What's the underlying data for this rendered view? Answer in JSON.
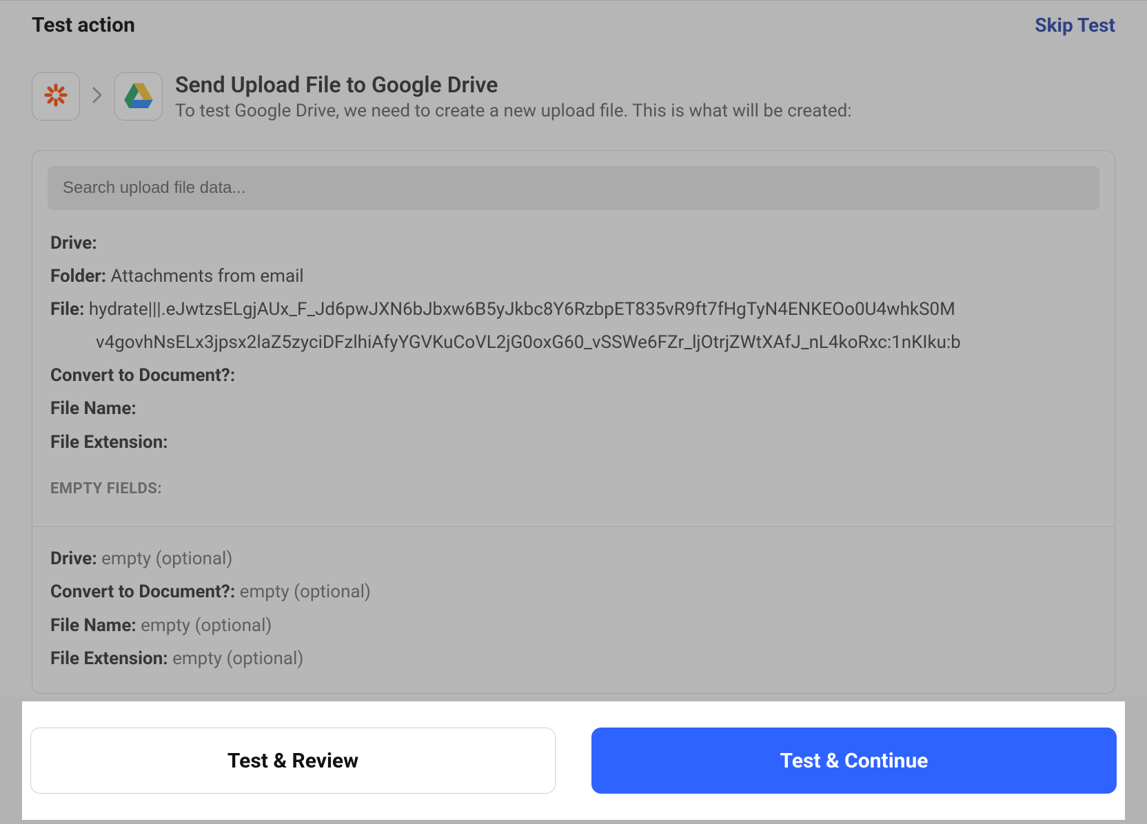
{
  "header": {
    "section_title": "Test action",
    "skip_label": "Skip Test"
  },
  "action": {
    "title": "Send Upload File to Google Drive",
    "subtitle": "To test Google Drive, we need to create a new upload file. This is what will be created:"
  },
  "search": {
    "placeholder": "Search upload file data..."
  },
  "fields": {
    "drive": {
      "label": "Drive:",
      "value": ""
    },
    "folder": {
      "label": "Folder:",
      "value": "Attachments from email"
    },
    "file": {
      "label": "File:",
      "value_line1": "hydrate|||.eJwtzsELgjAUx_F_Jd6pwJXN6bJbxw6B5yJkbc8Y6RzbpET835vR9ft7fHgTyN4ENKEOo0U4whkS0M",
      "value_line2": "v4govhNsELx3jpsx2laZ5zyciDFzlhiAfyYGVKuCoVL2jG0oxG60_vSSWe6FZr_ljOtrjZWtXAfJ_nL4koRxc:1nKIku:b"
    },
    "convert": {
      "label": "Convert to Document?:",
      "value": ""
    },
    "filename": {
      "label": "File Name:",
      "value": ""
    },
    "fileext": {
      "label": "File Extension:",
      "value": ""
    }
  },
  "empty": {
    "heading": "EMPTY FIELDS:",
    "rows": [
      {
        "label": "Drive:",
        "value": "empty (optional)"
      },
      {
        "label": "Convert to Document?:",
        "value": "empty (optional)"
      },
      {
        "label": "File Name:",
        "value": "empty (optional)"
      },
      {
        "label": "File Extension:",
        "value": "empty (optional)"
      }
    ]
  },
  "buttons": {
    "review": "Test & Review",
    "continue": "Test & Continue"
  },
  "colors": {
    "primary": "#2e63ff",
    "zapier": "#ff4a00",
    "drive_yellow": "#f7c427",
    "drive_green": "#1ea362",
    "drive_blue": "#2684fc"
  }
}
